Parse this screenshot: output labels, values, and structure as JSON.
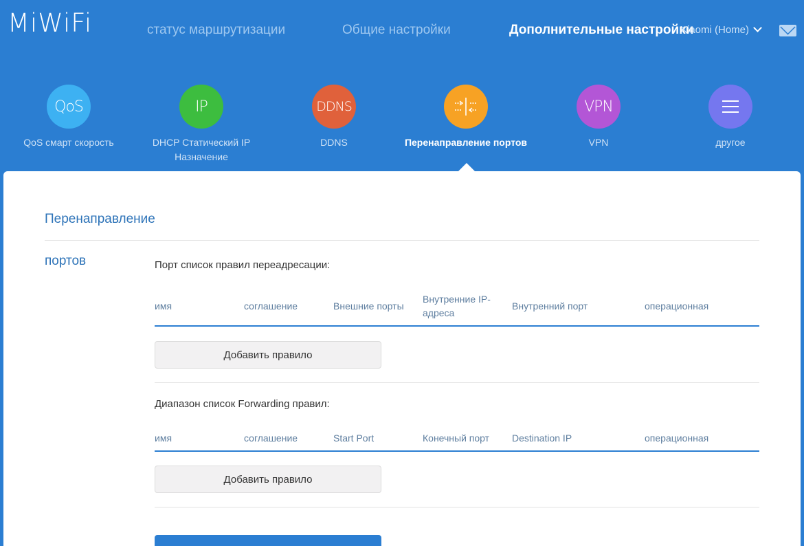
{
  "header": {
    "logo": "MiWiFi",
    "nav": [
      "статус маршрутизации",
      "Общие настройки",
      "Дополнительные настройки"
    ],
    "router_name": "Xiaomi (Home)"
  },
  "features": [
    {
      "icon_text": "QoS",
      "label": "QoS смарт скорость"
    },
    {
      "icon_text": "IP",
      "label": "DHCP Статический IP Назначение"
    },
    {
      "icon_text": "DDNS",
      "label": "DDNS"
    },
    {
      "icon_text": "",
      "label": "Перенаправление портов"
    },
    {
      "icon_text": "VPN",
      "label": "VPN"
    },
    {
      "icon_text": "",
      "label": "другое"
    }
  ],
  "panel": {
    "side_title_line1": "Перенаправление",
    "side_title_line2": "портов",
    "port_rules": {
      "title": "Порт список правил переадресации:",
      "columns": [
        "имя",
        "соглашение",
        "Внешние порты",
        "Внутренние IP-адреса",
        "Внутренний порт",
        "операционная"
      ],
      "add_button": "Добавить правило"
    },
    "range_rules": {
      "title": "Диапазон список Forwarding правил:",
      "columns": [
        "имя",
        "соглашение",
        "Start Port",
        "Конечный порт",
        "Destination IP",
        "операционная"
      ],
      "add_button": "Добавить правило"
    }
  },
  "colors": {
    "background": "#2b7ed2",
    "qos": "#3db1f2",
    "ip": "#3dbd3f",
    "ddns": "#e0613b",
    "port_forwarding": "#f7a224",
    "vpn": "#b356d6",
    "other": "#7577ef"
  },
  "icons": {
    "port_forwarding": "port-forward-arrows-icon",
    "other": "menu-lines-icon",
    "router_dropdown": "chevron-down-icon",
    "messages": "mail-icon"
  }
}
